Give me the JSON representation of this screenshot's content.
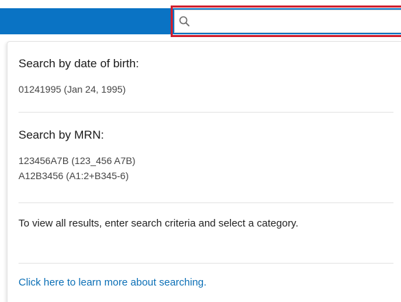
{
  "search": {
    "placeholder": "",
    "value": "",
    "icon": "search-icon"
  },
  "colors": {
    "header_bar": "#0a73c4",
    "highlight": "#d01f2e",
    "link": "#0b6fb6"
  },
  "dropdown": {
    "dob": {
      "title": "Search by date of birth:",
      "example": "01241995 (Jan 24, 1995)"
    },
    "mrn": {
      "title": "Search by MRN:",
      "examples": [
        "123456A7B (123_456 A7B)",
        "A12B3456 (A1:2+B345-6)"
      ]
    },
    "info": "To view all results, enter search criteria and select a category.",
    "learn_more_link": "Click here to learn more about searching."
  }
}
